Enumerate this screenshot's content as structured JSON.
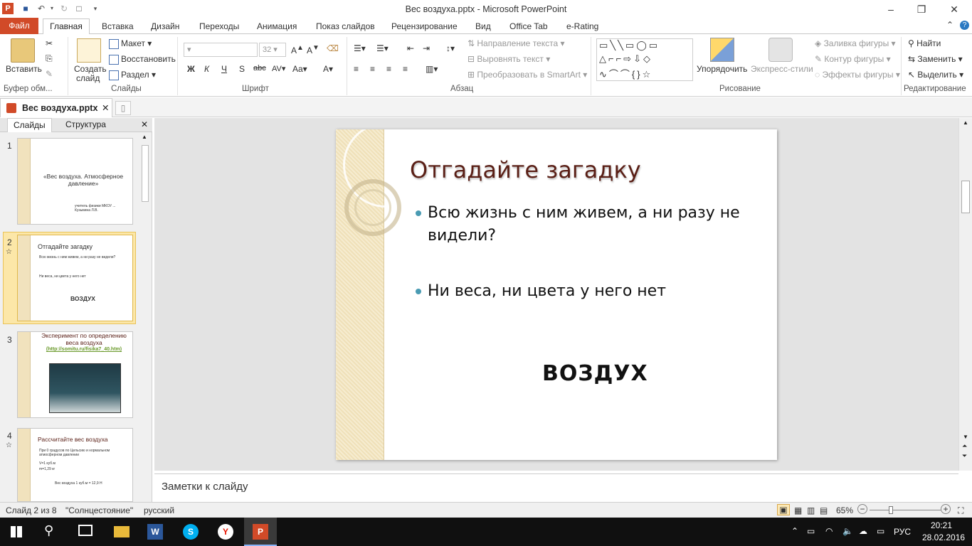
{
  "window": {
    "title": "Вес воздуха.pptx - Microsoft PowerPoint",
    "minimize_icon": "–",
    "restore_icon": "❐",
    "close_icon": "✕",
    "help_icon": "?",
    "collapse_icon": "⌃"
  },
  "ribbon_tabs": [
    "Файл",
    "Главная",
    "Вставка",
    "Дизайн",
    "Переходы",
    "Анимация",
    "Показ слайдов",
    "Рецензирование",
    "Вид",
    "Office Tab",
    "e-Rating"
  ],
  "ribbon": {
    "clipboard": {
      "paste": "Вставить",
      "group": "Буфер обм..."
    },
    "slides": {
      "new_slide_line1": "Создать",
      "new_slide_line2": "слайд",
      "layout": "Макет",
      "reset": "Восстановить",
      "section": "Раздел",
      "group": "Слайды"
    },
    "font": {
      "size": "32",
      "group": "Шрифт",
      "bold": "Ж",
      "italic": "К",
      "underline": "Ч",
      "shadow": "S",
      "strike": "abc"
    },
    "paragraph": {
      "text_direction": "Направление текста",
      "align_text": "Выровнять текст",
      "convert_smartart": "Преобразовать в SmartArt",
      "group": "Абзац"
    },
    "drawing": {
      "arrange": "Упорядочить",
      "quick_styles": "Экспресс-стили",
      "shape_fill": "Заливка фигуры",
      "shape_outline": "Контур фигуры",
      "shape_effects": "Эффекты фигуры",
      "group": "Рисование"
    },
    "editing": {
      "find": "Найти",
      "replace": "Заменить",
      "select": "Выделить",
      "group": "Редактирование"
    }
  },
  "doc_tab": {
    "label": "Вес воздуха.pptx"
  },
  "pane_tabs": [
    "Слайды",
    "Структура"
  ],
  "thumbnails": [
    {
      "num": "1",
      "title": "«Вес воздуха. Атмосферное давление»",
      "sub": "учитель физики МКОУ ... Кузьмина Л.В."
    },
    {
      "num": "2",
      "title": "Отгадайте загадку",
      "l1": "Всю жизнь с ним живем, а ни разу не видели?",
      "l2": "Ни веса, ни цвета у него нет",
      "answer": "ВОЗДУХ"
    },
    {
      "num": "3",
      "title": "Эксперимент по определению веса воздуха",
      "link": "(http://somitu.ru/fisika7_40.htm)"
    },
    {
      "num": "4",
      "title": "Рассчитайте вес воздуха",
      "l1": "При 0 градусов по Цельсию и нормальном атмосферном давлении",
      "l2": "V=1 куб.м",
      "l3": "m=1,29 кг",
      "l4": "Вес воздуха 1 куб.м = 12,9 Н"
    }
  ],
  "slide": {
    "title": "Отгадайте загадку",
    "bullet1": "Всю жизнь с ним живем, а ни разу не видели?",
    "bullet2": "Ни веса, ни цвета у него нет",
    "answer": "ВОЗДУХ"
  },
  "notes": {
    "placeholder": "Заметки к слайду"
  },
  "status": {
    "slide_of": "Слайд 2 из 8",
    "theme": "\"Солнцестояние\"",
    "language": "русский",
    "zoom": "65%"
  },
  "taskbar": {
    "lang": "РУС",
    "time": "20:21",
    "date": "28.02.2016"
  },
  "colors": {
    "file_tab": "#d14a28",
    "slide_title": "#5a1f16",
    "bullet": "#4a9bb3",
    "stripe": "#f1e2bd"
  }
}
